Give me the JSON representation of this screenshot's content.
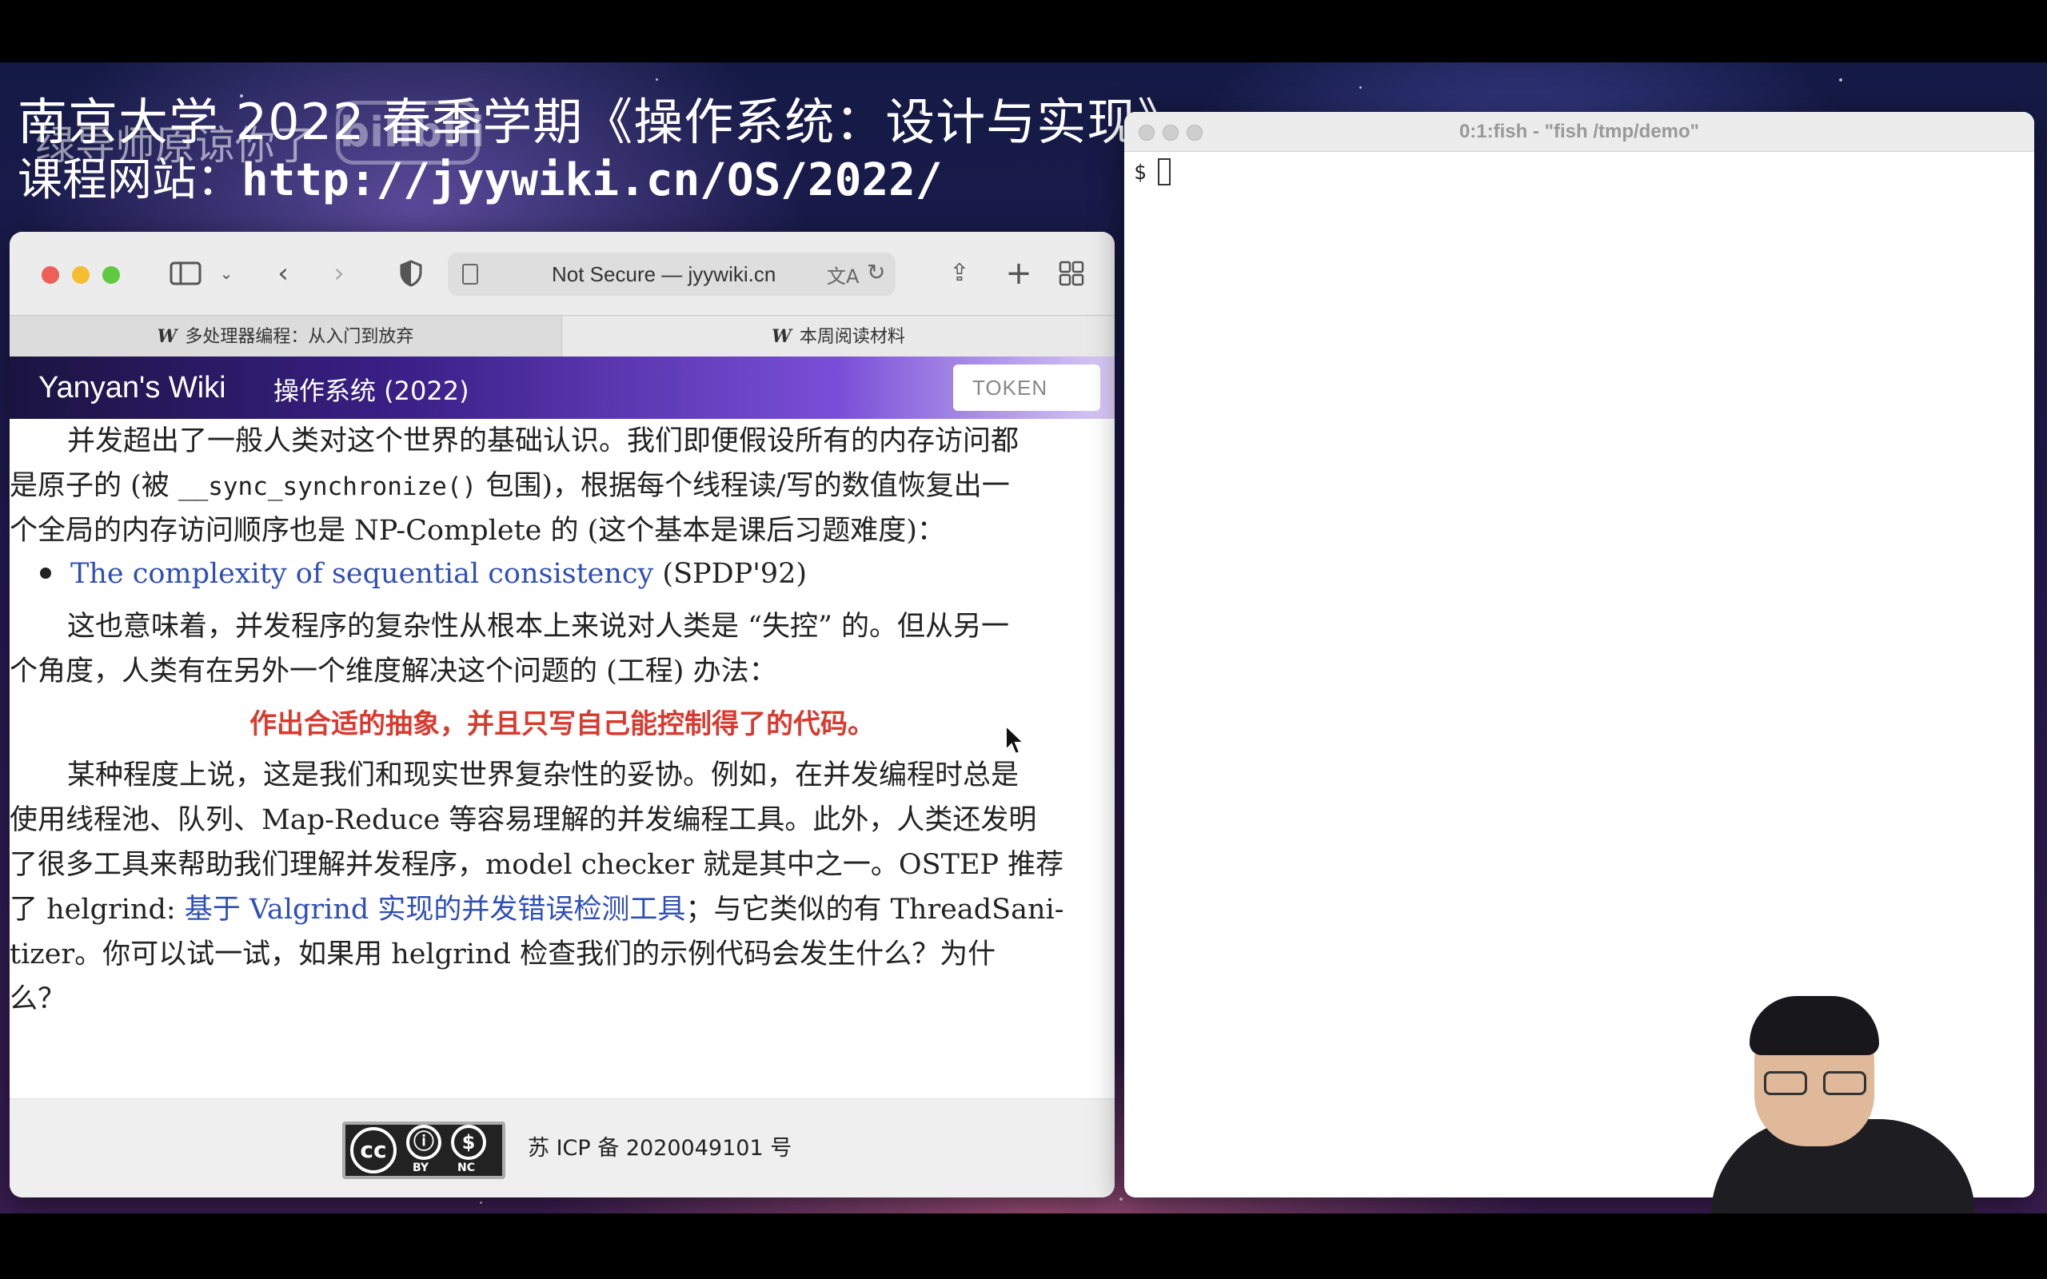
{
  "overlay": {
    "course_title": "南京大学 2022 春季学期《操作系统：设计与实现》",
    "course_site_label": "课程网站：",
    "course_site_url": "http://jyywiki.cn/OS/2022/",
    "danmaku": "绿导师原谅你了",
    "bilibili_logo": "bilibili"
  },
  "browser": {
    "address": "Not Secure — jyywiki.cn",
    "tabs": [
      {
        "icon": "W",
        "label": "多处理器编程：从入门到放弃"
      },
      {
        "icon": "W",
        "label": "本周阅读材料"
      }
    ],
    "wiki": {
      "site_name": "Yanyan's Wiki",
      "course": "操作系统 (2022)",
      "token_placeholder": "TOKEN"
    }
  },
  "article": {
    "p1_line1": "并发超出了一般人类对这个世界的基础认识。我们即便假设所有的内存访问都",
    "p1_line2_pre": "是原子的 (被 ",
    "p1_line2_code": "__sync_synchronize()",
    "p1_line2_post": " 包围)，根据每个线程读/写的数值恢复出一",
    "p1_line3": "个全局的内存访问顺序也是 NP-Complete 的 (这个基本是课后习题难度)：",
    "bullet_link": "The complexity of sequential consistency",
    "bullet_suffix": " (SPDP'92)",
    "p2_line1": "这也意味着，并发程序的复杂性从根本上来说对人类是 “失控” 的。但从另一",
    "p2_line2": "个角度，人类有在另外一个维度解决这个问题的 (工程) 办法：",
    "emphasis": "作出合适的抽象，并且只写自己能控制得了的代码。",
    "p3_line1": "某种程度上说，这是我们和现实世界复杂性的妥协。例如，在并发编程时总是",
    "p3_line2": "使用线程池、队列、Map-Reduce 等容易理解的并发编程工具。此外，人类还发明",
    "p3_line3": "了很多工具来帮助我们理解并发程序，model checker 就是其中之一。OSTEP 推荐",
    "p3_line4_pre": "了 helgrind: ",
    "p3_line4_link": "基于 Valgrind 实现的并发错误检测工具",
    "p3_line4_post": "；与它类似的有 ThreadSani-",
    "p3_line5": "tizer。你可以试一试，如果用 helgrind 检查我们的示例代码会发生什么？为什",
    "p3_line6": "么？"
  },
  "footer": {
    "license_badge": [
      "cc",
      "BY",
      "NC"
    ],
    "icp": "苏 ICP 备 2020049101 号"
  },
  "terminal": {
    "title": "0:1:fish - \"fish /tmp/demo\"",
    "prompt": "$"
  },
  "colors": {
    "link": "#2f4fb8",
    "emphasis": "#d93a2f",
    "wiki_bar_start": "#1a1440",
    "wiki_bar_end": "#d9ccf5"
  }
}
